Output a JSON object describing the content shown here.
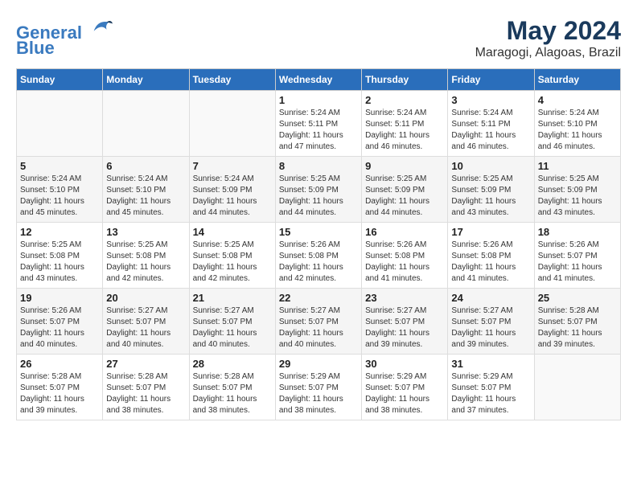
{
  "header": {
    "logo_line1": "General",
    "logo_line2": "Blue",
    "main_title": "May 2024",
    "sub_title": "Maragogi, Alagoas, Brazil"
  },
  "days_of_week": [
    "Sunday",
    "Monday",
    "Tuesday",
    "Wednesday",
    "Thursday",
    "Friday",
    "Saturday"
  ],
  "weeks": [
    {
      "days": [
        {
          "num": "",
          "info": ""
        },
        {
          "num": "",
          "info": ""
        },
        {
          "num": "",
          "info": ""
        },
        {
          "num": "1",
          "info": "Sunrise: 5:24 AM\nSunset: 5:11 PM\nDaylight: 11 hours\nand 47 minutes."
        },
        {
          "num": "2",
          "info": "Sunrise: 5:24 AM\nSunset: 5:11 PM\nDaylight: 11 hours\nand 46 minutes."
        },
        {
          "num": "3",
          "info": "Sunrise: 5:24 AM\nSunset: 5:11 PM\nDaylight: 11 hours\nand 46 minutes."
        },
        {
          "num": "4",
          "info": "Sunrise: 5:24 AM\nSunset: 5:10 PM\nDaylight: 11 hours\nand 46 minutes."
        }
      ]
    },
    {
      "days": [
        {
          "num": "5",
          "info": "Sunrise: 5:24 AM\nSunset: 5:10 PM\nDaylight: 11 hours\nand 45 minutes."
        },
        {
          "num": "6",
          "info": "Sunrise: 5:24 AM\nSunset: 5:10 PM\nDaylight: 11 hours\nand 45 minutes."
        },
        {
          "num": "7",
          "info": "Sunrise: 5:24 AM\nSunset: 5:09 PM\nDaylight: 11 hours\nand 44 minutes."
        },
        {
          "num": "8",
          "info": "Sunrise: 5:25 AM\nSunset: 5:09 PM\nDaylight: 11 hours\nand 44 minutes."
        },
        {
          "num": "9",
          "info": "Sunrise: 5:25 AM\nSunset: 5:09 PM\nDaylight: 11 hours\nand 44 minutes."
        },
        {
          "num": "10",
          "info": "Sunrise: 5:25 AM\nSunset: 5:09 PM\nDaylight: 11 hours\nand 43 minutes."
        },
        {
          "num": "11",
          "info": "Sunrise: 5:25 AM\nSunset: 5:09 PM\nDaylight: 11 hours\nand 43 minutes."
        }
      ]
    },
    {
      "days": [
        {
          "num": "12",
          "info": "Sunrise: 5:25 AM\nSunset: 5:08 PM\nDaylight: 11 hours\nand 43 minutes."
        },
        {
          "num": "13",
          "info": "Sunrise: 5:25 AM\nSunset: 5:08 PM\nDaylight: 11 hours\nand 42 minutes."
        },
        {
          "num": "14",
          "info": "Sunrise: 5:25 AM\nSunset: 5:08 PM\nDaylight: 11 hours\nand 42 minutes."
        },
        {
          "num": "15",
          "info": "Sunrise: 5:26 AM\nSunset: 5:08 PM\nDaylight: 11 hours\nand 42 minutes."
        },
        {
          "num": "16",
          "info": "Sunrise: 5:26 AM\nSunset: 5:08 PM\nDaylight: 11 hours\nand 41 minutes."
        },
        {
          "num": "17",
          "info": "Sunrise: 5:26 AM\nSunset: 5:08 PM\nDaylight: 11 hours\nand 41 minutes."
        },
        {
          "num": "18",
          "info": "Sunrise: 5:26 AM\nSunset: 5:07 PM\nDaylight: 11 hours\nand 41 minutes."
        }
      ]
    },
    {
      "days": [
        {
          "num": "19",
          "info": "Sunrise: 5:26 AM\nSunset: 5:07 PM\nDaylight: 11 hours\nand 40 minutes."
        },
        {
          "num": "20",
          "info": "Sunrise: 5:27 AM\nSunset: 5:07 PM\nDaylight: 11 hours\nand 40 minutes."
        },
        {
          "num": "21",
          "info": "Sunrise: 5:27 AM\nSunset: 5:07 PM\nDaylight: 11 hours\nand 40 minutes."
        },
        {
          "num": "22",
          "info": "Sunrise: 5:27 AM\nSunset: 5:07 PM\nDaylight: 11 hours\nand 40 minutes."
        },
        {
          "num": "23",
          "info": "Sunrise: 5:27 AM\nSunset: 5:07 PM\nDaylight: 11 hours\nand 39 minutes."
        },
        {
          "num": "24",
          "info": "Sunrise: 5:27 AM\nSunset: 5:07 PM\nDaylight: 11 hours\nand 39 minutes."
        },
        {
          "num": "25",
          "info": "Sunrise: 5:28 AM\nSunset: 5:07 PM\nDaylight: 11 hours\nand 39 minutes."
        }
      ]
    },
    {
      "days": [
        {
          "num": "26",
          "info": "Sunrise: 5:28 AM\nSunset: 5:07 PM\nDaylight: 11 hours\nand 39 minutes."
        },
        {
          "num": "27",
          "info": "Sunrise: 5:28 AM\nSunset: 5:07 PM\nDaylight: 11 hours\nand 38 minutes."
        },
        {
          "num": "28",
          "info": "Sunrise: 5:28 AM\nSunset: 5:07 PM\nDaylight: 11 hours\nand 38 minutes."
        },
        {
          "num": "29",
          "info": "Sunrise: 5:29 AM\nSunset: 5:07 PM\nDaylight: 11 hours\nand 38 minutes."
        },
        {
          "num": "30",
          "info": "Sunrise: 5:29 AM\nSunset: 5:07 PM\nDaylight: 11 hours\nand 38 minutes."
        },
        {
          "num": "31",
          "info": "Sunrise: 5:29 AM\nSunset: 5:07 PM\nDaylight: 11 hours\nand 37 minutes."
        },
        {
          "num": "",
          "info": ""
        }
      ]
    }
  ]
}
